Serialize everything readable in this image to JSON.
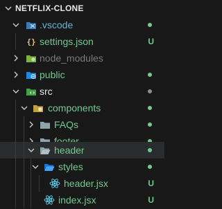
{
  "explorer": {
    "root": {
      "label": "NETFLIX-CLONE"
    },
    "items": [
      {
        "label": "vscode",
        "prefix": ".",
        "icon": "vscode-folder-icon",
        "expanded": true,
        "color": "#5fb8d4",
        "status_color": "#73c991"
      },
      {
        "label": "settings.json",
        "icon": "json-braces-icon",
        "color": "#73c991",
        "badge": "U",
        "badge_color": "#73c991"
      },
      {
        "label": "node_modules",
        "icon": "node-folder-icon",
        "expanded": false,
        "color": "#7a7a7a"
      },
      {
        "label": "public",
        "icon": "globe-folder-icon",
        "expanded": false,
        "color": "#73c991",
        "status_color": "#73c991"
      },
      {
        "label": "src",
        "icon": "src-folder-icon",
        "expanded": true,
        "color": "#e8e8e8",
        "status_color": "#8b8b8b"
      },
      {
        "label": "components",
        "icon": "components-folder-icon",
        "expanded": true,
        "color": "#73c991",
        "status_color": "#73c991"
      },
      {
        "label": "FAQs",
        "icon": "folder-icon",
        "expanded": false,
        "color": "#73c991",
        "status_color": "#73c991"
      },
      {
        "label": "footer",
        "icon": "folder-icon",
        "expanded": false,
        "color": "#73c991",
        "status_color": "#73c991"
      },
      {
        "label": "header",
        "icon": "folder-icon",
        "expanded": true,
        "color": "#73c991",
        "status_color": "#73c991"
      },
      {
        "label": "styles",
        "icon": "styles-folder-icon",
        "expanded": true,
        "color": "#73c991",
        "status_color": "#73c991"
      },
      {
        "label": "header.jsx",
        "icon": "react-icon",
        "color": "#73c991",
        "badge": "U",
        "badge_color": "#73c991"
      },
      {
        "label": "index.jsx",
        "icon": "react-icon",
        "color": "#73c991",
        "badge": "U",
        "badge_color": "#73c991"
      }
    ]
  },
  "colors": {
    "background": "#181818",
    "selected_row": "#2a2d2e",
    "untracked_green": "#73c991",
    "chevron": "#cccccc",
    "indent_guide": "#3b3b3b"
  }
}
